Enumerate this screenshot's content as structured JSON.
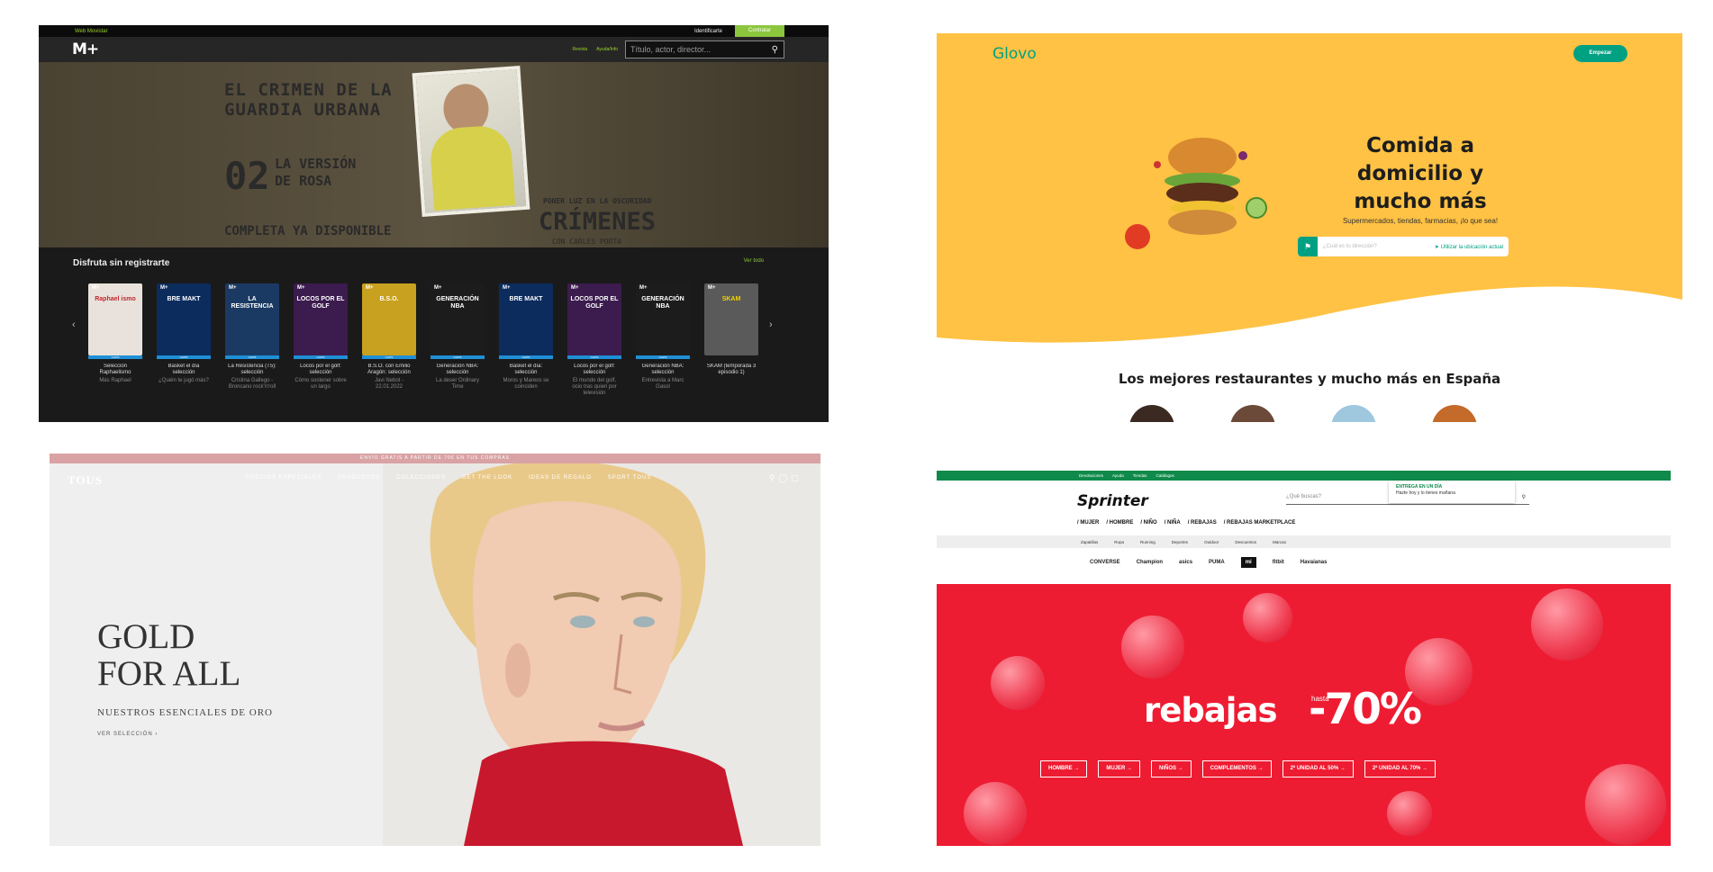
{
  "movistar": {
    "topbar": {
      "left_link": "Web Movistar",
      "login": "Identificarte",
      "cta": "Contratar"
    },
    "logo": "M+",
    "nav_links": [
      "Revista",
      "Ayuda/Info"
    ],
    "search_placeholder": "Título, actor, director...",
    "hero": {
      "title": "EL CRIMEN DE LA\nGUARDIA URBANA",
      "episode_number": "02",
      "episode_title": "LA VERSIÓN\nDE ROSA",
      "availability": "COMPLETA YA DISPONIBLE",
      "tagline": "PONER LUZ EN LA OSCURIDAD",
      "series": "CRÍMENES",
      "byline": "CON CARLES PORTA"
    },
    "strip_title": "Disfruta sin registrarte",
    "see_all": "Ver todo",
    "cards": [
      {
        "poster_text": "Raphael ismo",
        "badge": "CLIPS",
        "title": "Selección Raphaelismo",
        "subtitle": "Más Raphael",
        "color": "#e9e2dc",
        "text_color": "#c0272d"
      },
      {
        "poster_text": "BRE MAKT",
        "badge": "CLIPS",
        "title": "Basket el día selección",
        "subtitle": "¿Quién te jugó más?",
        "color": "#0c2c5e",
        "text_color": "#ffffff"
      },
      {
        "poster_text": "LA RESISTENCIA",
        "badge": "CLIPS",
        "title": "La Resistencia (T5): selección",
        "subtitle": "Cristina Gallego - Broncano rock'n'roll",
        "color": "#1b3a63",
        "text_color": "#ffffff"
      },
      {
        "poster_text": "LOCOS POR EL GOLF",
        "badge": "CLIPS",
        "title": "Locos por el golf: selección",
        "subtitle": "Cómo sostener sobre un largo",
        "color": "#3c1c4e",
        "text_color": "#ffffff"
      },
      {
        "poster_text": "B.S.O.",
        "badge": "CLIPS",
        "title": "B.S.O. con Emilio Aragón: selección",
        "subtitle": "Javi Nebot - 22.01.2022",
        "color": "#c7a11f",
        "text_color": "#ffffff"
      },
      {
        "poster_text": "GENERACIÓN NBA",
        "badge": "CLIPS",
        "title": "Generación NBA: selección",
        "subtitle": "La deser Ordinary Time",
        "color": "#1c1c1c",
        "text_color": "#ffffff"
      },
      {
        "poster_text": "BRE MAKT",
        "badge": "CLIPS",
        "title": "Basket el día: selección",
        "subtitle": "Moros y Mareos se coinciden",
        "color": "#0c2c5e",
        "text_color": "#ffffff"
      },
      {
        "poster_text": "LOCOS POR EL GOLF",
        "badge": "CLIPS",
        "title": "Locos por el golf: selección",
        "subtitle": "El mundo del golf, ocio tras quien por televisión",
        "color": "#3c1c4e",
        "text_color": "#ffffff"
      },
      {
        "poster_text": "GENERACIÓN NBA",
        "badge": "CLIPS",
        "title": "Generación NBA: selección",
        "subtitle": "Entrevista a Marc Gasol",
        "color": "#1c1c1c",
        "text_color": "#ffffff"
      },
      {
        "poster_text": "SKAM",
        "badge": "",
        "title": "SKAM (temporada 3 episodio 1)",
        "subtitle": "",
        "color": "#5a5a5a",
        "text_color": "#f2d200"
      }
    ]
  },
  "glovo": {
    "logo": "Glovo",
    "cta": "Empezar",
    "headline": "Comida a\ndomicilio y\nmucho más",
    "subhead": "Supermercados, tiendas, farmacias, ¡lo que sea!",
    "address_placeholder": "¿Cuál es tu dirección?",
    "use_location": "Utilizar la ubicación actual",
    "restaurants_title": "Los mejores restaurantes y mucho más en España",
    "bg_color": "#ffc244",
    "accent": "#00a082"
  },
  "tous": {
    "promo": "ENVÍO GRATIS A PARTIR DE 70€ EN TUS COMPRAS",
    "logo": "TOUS",
    "nav": [
      "PRECIOS ESPECIALES",
      "PRODUCTOS",
      "COLECCIONES",
      "GET THE LOOK",
      "IDEAS DE REGALO",
      "SPORT TOUS"
    ],
    "icons": [
      "search-icon",
      "user-icon",
      "bag-icon"
    ],
    "headline": "GOLD\nFOR ALL",
    "subhead": "NUESTROS ESENCIALES DE ORO",
    "cta": "VER SELECCIÓN"
  },
  "sprinter": {
    "topbar": [
      "Devoluciones",
      "Ayuda",
      "Tiendas",
      "Catálogos"
    ],
    "logo": "Sprinter",
    "dropdown_title": "ENTREGA EN UN DÍA",
    "dropdown_text": "Hazte hoy y lo tienes mañana",
    "search_placeholder": "¿Qué buscas?",
    "main_nav": [
      "/ MUJER",
      "/ HOMBRE",
      "/ NIÑO",
      "/ NIÑA",
      "/ REBAJAS",
      "/ REBAJAS MARKETPLACE"
    ],
    "sub_nav": [
      "Zapatillas",
      "Ropa",
      "Running",
      "Deportes",
      "Outdoor",
      "Descuentos",
      "Marcas"
    ],
    "brands": [
      "CONVERSE",
      "Champion",
      "asics",
      "PUMA",
      "mi",
      "fitbit",
      "Havaianas"
    ],
    "headline": "rebajas",
    "hasta": "hasta",
    "discount": "-70%",
    "categories": [
      "HOMBRE →",
      "MUJER →",
      "NIÑOS →",
      "COMPLEMENTOS →",
      "2ª UNIDAD AL 50% →",
      "2ª UNIDAD AL 70% →"
    ],
    "accent": "#ee1c32"
  }
}
